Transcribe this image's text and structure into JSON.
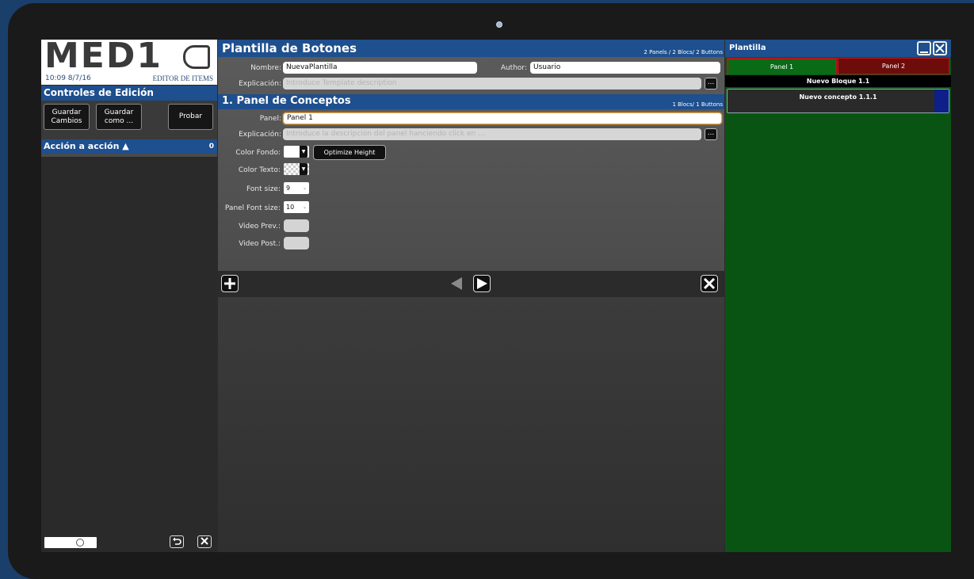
{
  "left": {
    "logo": "MED1",
    "time": "10:09 8/7/16",
    "editor_label": "EDITOR DE ITEMS",
    "controls_header": "Controles de Edición",
    "buttons": {
      "save_changes_l1": "Guardar",
      "save_changes_l2": "Cambios",
      "save_as_l1": "Guardar",
      "save_as_l2": "como ...",
      "test": "Probar"
    },
    "accion_label": "Acción a acción ▲",
    "accion_count": "0"
  },
  "template": {
    "title": "Plantilla de Botones",
    "counts": "2 Panels / 2 Blocs/ 2 Buttons",
    "name_label": "Nombre:",
    "name_value": "NuevaPlantilla",
    "author_label": "Author:",
    "author_value": "Usuario",
    "desc_label": "Explicación:",
    "desc_placeholder": "Introduce Template description"
  },
  "panel": {
    "title": "1. Panel de Conceptos",
    "counts": "1 Blocs/ 1 Buttons",
    "panel_label": "Panel:",
    "panel_value": "Panel 1",
    "desc_label": "Explicación:",
    "desc_placeholder": "Introduce la descripción del panel hanciendo click en ...",
    "color_fondo_label": "Color Fondo:",
    "optimize_label": "Optimize Height",
    "color_texto_label": "Color Texto:",
    "font_size_label": "Font size:",
    "font_size_value": "9",
    "panel_font_size_label": "Panel Font size:",
    "panel_font_size_value": "10",
    "video_prev_label": "Video Prev.:",
    "video_post_label": "Video Post.:"
  },
  "preview": {
    "title": "Plantilla",
    "tabs": [
      "Panel 1",
      "Panel 2"
    ],
    "block": "Nuevo Bloque 1.1",
    "concept": "Nuevo concepto 1.1.1"
  },
  "colors": {
    "header_blue": "#1e4f8e",
    "preview_green": "#0a5413",
    "tab_active": "#0a6b16",
    "tab_inactive": "#6e0c0c",
    "focus_orange": "#e8a23a"
  }
}
